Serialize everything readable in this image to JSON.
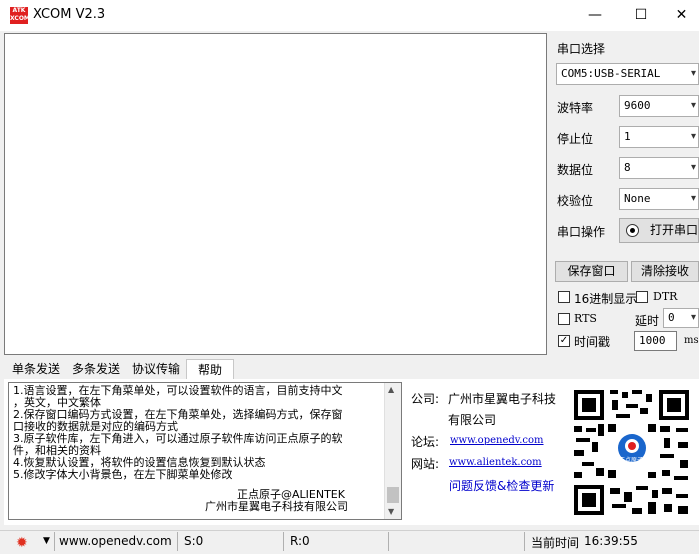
{
  "window": {
    "title": "XCOM V2.3",
    "logo_text": "ATK XCOM",
    "minimize": "—",
    "maximize": "☐",
    "close": "✕"
  },
  "serial": {
    "port_label": "串口选择",
    "port_value": "COM5:USB-SERIAL",
    "baud_label": "波特率",
    "baud_value": "9600",
    "stopbit_label": "停止位",
    "stopbit_value": "1",
    "databit_label": "数据位",
    "databit_value": "8",
    "parity_label": "校验位",
    "parity_value": "None",
    "op_label": "串口操作",
    "open_button": "打开串口",
    "save_window": "保存窗口",
    "clear_recv": "清除接收",
    "hex_display": "16进制显示",
    "dtr": "DTR",
    "rts": "RTS",
    "delay_label": "延时",
    "delay_value": "0",
    "timestamp": "时间戳",
    "timestamp_checked": true,
    "interval_value": "1000",
    "interval_unit": "ms"
  },
  "tabs": [
    "单条发送",
    "多条发送",
    "协议传输",
    "帮助"
  ],
  "help": {
    "lines": [
      "1.语言设置，在左下角菜单处，可以设置软件的语言，目前支持中文",
      "，英文，中文繁体",
      "2.保存窗口编码方式设置，在左下角菜单处，选择编码方式，保存窗",
      "口接收的数据就是对应的编码方式",
      "3.原子软件库，左下角进入，可以通过原子软件库访问正点原子的软",
      "件，和相关的资料",
      "4.恢复默认设置，将软件的设置信息恢复到默认状态",
      "5.修改字体大小背景色，在左下脚菜单处修改"
    ],
    "sign1": "正点原子@ALIENTEK",
    "sign2": "广州市星翼电子科技有限公司"
  },
  "company": {
    "company_label": "公司:",
    "company_line1": "广州市星翼电子科技",
    "company_line2": "有限公司",
    "forum_label": "论坛:",
    "forum_url": "www.openedv.com",
    "site_label": "网站:",
    "site_url": "www.alientek.com",
    "feedback": "问题反馈&检查更新",
    "qr_logo": "正点原子"
  },
  "status": {
    "menu_icon": "gear-icon",
    "website": "www.openedv.com",
    "sent": "S:0",
    "recv": "R:0",
    "time_label": "当前时间",
    "time": "16:39:55"
  },
  "colors": {
    "accent_red": "#e02020",
    "link_blue": "#0000cc"
  }
}
